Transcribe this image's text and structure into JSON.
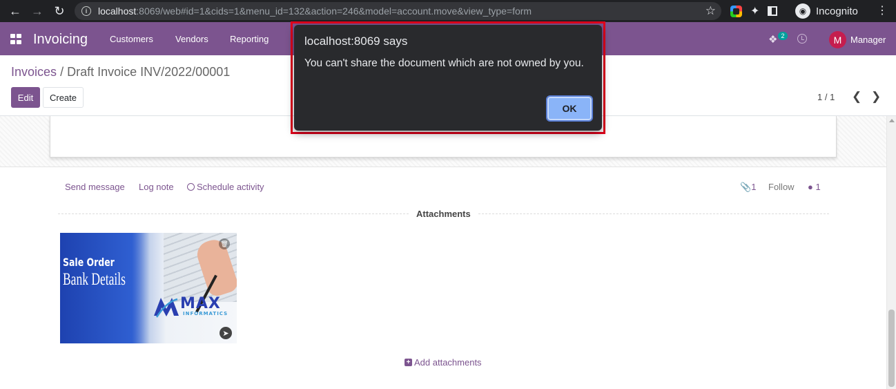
{
  "browser": {
    "url_host": "localhost",
    "url_rest": ":8069/web#id=1&cids=1&menu_id=132&action=246&model=account.move&view_type=form",
    "profile_label": "Incognito"
  },
  "navbar": {
    "app_name": "Invoicing",
    "menu": [
      "Customers",
      "Vendors",
      "Reporting"
    ],
    "chat_badge": "2",
    "user_initial": "M",
    "user_name": "Manager",
    "color": "#7c548f"
  },
  "control_panel": {
    "breadcrumb_parent": "Invoices",
    "breadcrumb_separator": "/",
    "breadcrumb_current": "Draft Invoice INV/2022/00001",
    "edit_label": "Edit",
    "create_label": "Create",
    "pager": "1 / 1"
  },
  "chatter": {
    "send_message": "Send message",
    "log_note": "Log note",
    "schedule_activity": "Schedule activity",
    "attachment_count": "1",
    "follow_label": "Follow",
    "follower_count": "1",
    "attachments_title": "Attachments",
    "add_attachments": "Add attachments",
    "attachment_image": {
      "line1": "Sale Order",
      "line2": "Bank Details",
      "logo_text": "MAX",
      "logo_sub": "INFORMATICS"
    }
  },
  "alert": {
    "title": "localhost:8069 says",
    "message": "You can't share the document which are not owned by you.",
    "ok_label": "OK",
    "highlight_color": "#e3001b"
  }
}
